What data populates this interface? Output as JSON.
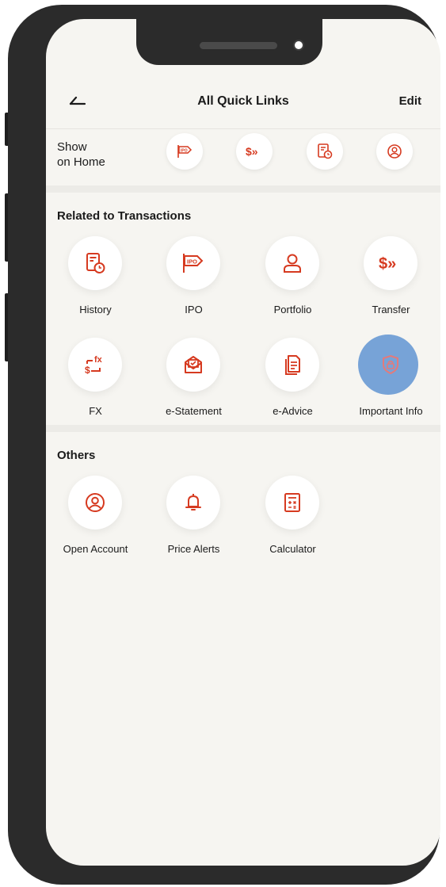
{
  "colors": {
    "accent": "#d63a20",
    "background": "#f6f5f1",
    "highlight": "#6094d2"
  },
  "header": {
    "back_icon": "back-arrow-icon",
    "title": "All Quick Links",
    "edit_label": "Edit"
  },
  "show_on_home": {
    "label_line1": "Show",
    "label_line2": "on Home",
    "icons": [
      "ipo-icon",
      "transfer-icon",
      "history-icon",
      "open-account-icon"
    ]
  },
  "sections": {
    "transactions": {
      "title": "Related to Transactions",
      "items": [
        {
          "label": "History",
          "icon": "history-icon"
        },
        {
          "label": "IPO",
          "icon": "ipo-icon"
        },
        {
          "label": "Portfolio",
          "icon": "portfolio-icon"
        },
        {
          "label": "Transfer",
          "icon": "transfer-icon"
        },
        {
          "label": "FX",
          "icon": "fx-icon"
        },
        {
          "label": "e-Statement",
          "icon": "e-statement-icon"
        },
        {
          "label": "e-Advice",
          "icon": "e-advice-icon"
        },
        {
          "label": "Important Info",
          "icon": "important-info-icon"
        }
      ]
    },
    "others": {
      "title": "Others",
      "items": [
        {
          "label": "Open Account",
          "icon": "open-account-icon"
        },
        {
          "label": "Price Alerts",
          "icon": "price-alerts-icon"
        },
        {
          "label": "Calculator",
          "icon": "calculator-icon"
        }
      ]
    }
  }
}
